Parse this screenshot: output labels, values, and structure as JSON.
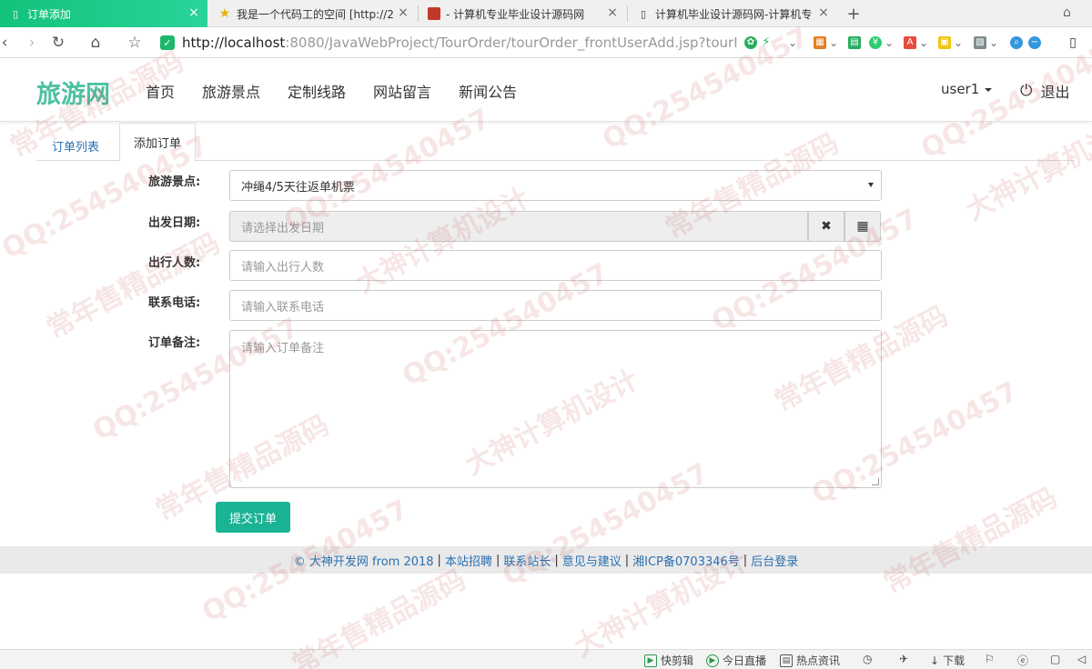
{
  "browser": {
    "tabs": [
      {
        "label": "订单添加",
        "active": true
      },
      {
        "label": "我是一个代码工的空间 [http://2",
        "active": false
      },
      {
        "label": "- 计算机专业毕业设计源码网",
        "active": false
      },
      {
        "label": "计算机毕业设计源码网-计算机专",
        "active": false
      }
    ],
    "new_tab": "+",
    "url_host": "http://localhost",
    "url_rest": ":8080/JavaWebProject/TourOrder/tourOrder_frontUserAdd.jsp?tourI"
  },
  "header": {
    "logo": "旅游网",
    "menu": [
      "首页",
      "旅游景点",
      "定制线路",
      "网站留言",
      "新闻公告"
    ],
    "user": "user1",
    "logout": "退出"
  },
  "subtabs": [
    "订单列表",
    "添加订单"
  ],
  "form": {
    "spot_label": "旅游景点:",
    "spot_value": "冲绳4/5天往返单机票",
    "date_label": "出发日期:",
    "date_placeholder": "请选择出发日期",
    "count_label": "出行人数:",
    "count_placeholder": "请输入出行人数",
    "phone_label": "联系电话:",
    "phone_placeholder": "请输入联系电话",
    "memo_label": "订单备注:",
    "memo_placeholder": "请输入订单备注",
    "submit": "提交订单"
  },
  "footer": {
    "items": [
      "© 大神开发网 from 2018",
      "本站招聘",
      "联系站长",
      "意见与建议",
      "湘ICP备0703346号",
      "后台登录"
    ]
  },
  "statusbar": {
    "items": [
      "快剪辑",
      "今日直播",
      "热点资讯",
      "下载"
    ]
  },
  "watermark": {
    "texts": [
      "QQ:254540457",
      "常年售精品源码",
      "大神计算机设计"
    ]
  },
  "colors": {
    "accent": "#1ab394",
    "logo": "#4cc1a1",
    "link": "#2a6fb0",
    "tab_active": "#12c27a"
  }
}
